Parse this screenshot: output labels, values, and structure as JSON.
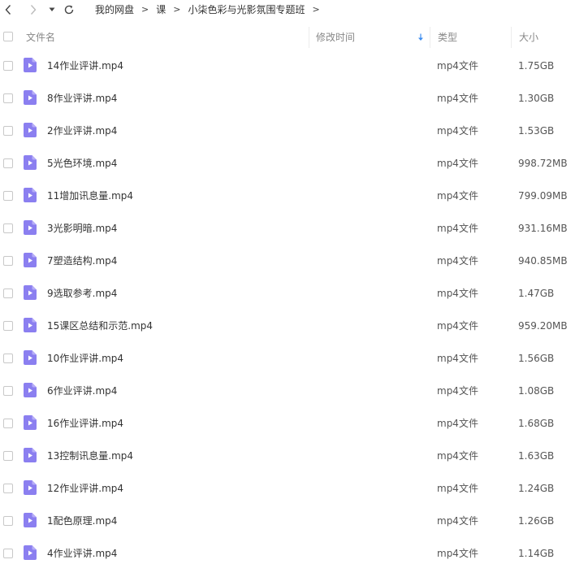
{
  "breadcrumb": {
    "items": [
      "我的网盘",
      "课",
      "小柒色彩与光影氛围专题班"
    ],
    "separator": ">"
  },
  "header": {
    "name": "文件名",
    "time": "修改时间",
    "type": "类型",
    "size": "大小"
  },
  "icons": {
    "file": "video-file-icon",
    "file_color": "#8b7ff0"
  },
  "files": [
    {
      "name": "14作业评讲.mp4",
      "type": "mp4文件",
      "size": "1.75GB"
    },
    {
      "name": "8作业评讲.mp4",
      "type": "mp4文件",
      "size": "1.30GB"
    },
    {
      "name": "2作业评讲.mp4",
      "type": "mp4文件",
      "size": "1.53GB"
    },
    {
      "name": "5光色环境.mp4",
      "type": "mp4文件",
      "size": "998.72MB"
    },
    {
      "name": "11增加讯息量.mp4",
      "type": "mp4文件",
      "size": "799.09MB"
    },
    {
      "name": "3光影明暗.mp4",
      "type": "mp4文件",
      "size": "931.16MB"
    },
    {
      "name": "7塑造结构.mp4",
      "type": "mp4文件",
      "size": "940.85MB"
    },
    {
      "name": "9选取参考.mp4",
      "type": "mp4文件",
      "size": "1.47GB"
    },
    {
      "name": "15课区总结和示范.mp4",
      "type": "mp4文件",
      "size": "959.20MB"
    },
    {
      "name": "10作业评讲.mp4",
      "type": "mp4文件",
      "size": "1.56GB"
    },
    {
      "name": "6作业评讲.mp4",
      "type": "mp4文件",
      "size": "1.08GB"
    },
    {
      "name": "16作业评讲.mp4",
      "type": "mp4文件",
      "size": "1.68GB"
    },
    {
      "name": "13控制讯息量.mp4",
      "type": "mp4文件",
      "size": "1.63GB"
    },
    {
      "name": "12作业评讲.mp4",
      "type": "mp4文件",
      "size": "1.24GB"
    },
    {
      "name": "1配色原理.mp4",
      "type": "mp4文件",
      "size": "1.26GB"
    },
    {
      "name": "4作业评讲.mp4",
      "type": "mp4文件",
      "size": "1.14GB"
    }
  ]
}
